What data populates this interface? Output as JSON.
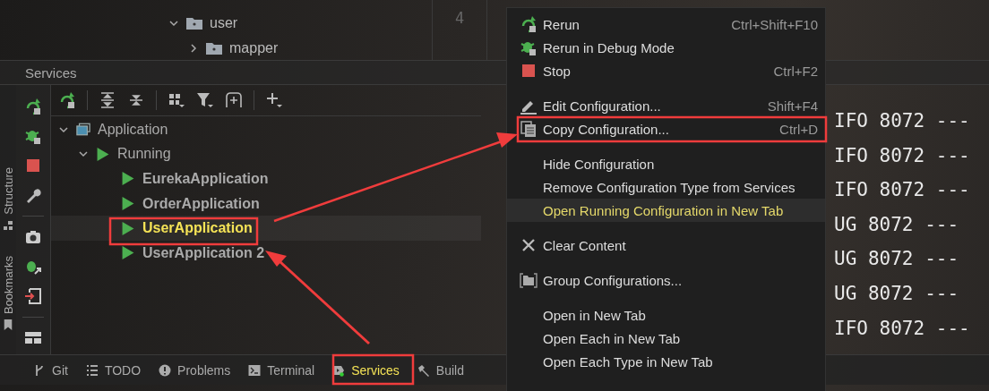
{
  "project_tree": [
    {
      "label": "user",
      "expanded": true,
      "children": [
        {
          "label": "mapper",
          "expanded": false
        }
      ]
    }
  ],
  "editor": {
    "line_number": "4"
  },
  "services": {
    "title": "Services",
    "side_labels": [
      "Structure",
      "Bookmarks"
    ],
    "tree": [
      {
        "label": "Application",
        "expanded": true,
        "kind": "group",
        "children": [
          {
            "label": "Running",
            "expanded": true,
            "kind": "status",
            "children": [
              {
                "label": "EurekaApplication",
                "kind": "app",
                "selected": false
              },
              {
                "label": "OrderApplication",
                "kind": "app",
                "selected": false
              },
              {
                "label": "UserApplication",
                "kind": "app",
                "selected": true
              },
              {
                "label": "UserApplication 2",
                "kind": "app",
                "selected": false
              }
            ]
          }
        ]
      }
    ]
  },
  "console_lines": [
    "IFO 8072 ---",
    "IFO 8072 ---",
    "IFO 8072 ---",
    "UG 8072 ---",
    "UG 8072 ---",
    "UG 8072 ---",
    "IFO 8072 ---"
  ],
  "context_menu": [
    {
      "kind": "item",
      "label": "Rerun",
      "shortcut": "Ctrl+Shift+F10",
      "highlighted": false
    },
    {
      "kind": "item",
      "label": "Rerun in Debug Mode",
      "highlighted": false
    },
    {
      "kind": "item",
      "label": "Stop",
      "shortcut": "Ctrl+F2",
      "highlighted": false
    },
    {
      "kind": "separator"
    },
    {
      "kind": "item",
      "label": "Edit Configuration...",
      "shortcut": "Shift+F4",
      "highlighted": false
    },
    {
      "kind": "item",
      "label": "Copy Configuration...",
      "shortcut": "Ctrl+D",
      "highlighted": false
    },
    {
      "kind": "separator"
    },
    {
      "kind": "item",
      "label": "Hide Configuration",
      "highlighted": false
    },
    {
      "kind": "item",
      "label": "Remove Configuration Type from Services",
      "highlighted": false
    },
    {
      "kind": "item",
      "label": "Open Running Configuration in New Tab",
      "highlighted": true
    },
    {
      "kind": "separator"
    },
    {
      "kind": "item",
      "label": "Clear Content",
      "highlighted": false
    },
    {
      "kind": "separator"
    },
    {
      "kind": "item",
      "label": "Group Configurations...",
      "highlighted": false
    },
    {
      "kind": "separator"
    },
    {
      "kind": "item",
      "label": "Open in New Tab",
      "highlighted": false
    },
    {
      "kind": "item",
      "label": "Open Each in New Tab",
      "highlighted": false
    },
    {
      "kind": "item",
      "label": "Open Each Type in New Tab",
      "highlighted": false
    }
  ],
  "bottom_tabs": [
    {
      "label": "Git",
      "selected": false
    },
    {
      "label": "TODO",
      "selected": false
    },
    {
      "label": "Problems",
      "selected": false
    },
    {
      "label": "Terminal",
      "selected": false
    },
    {
      "label": "Services",
      "selected": true
    },
    {
      "label": "Build",
      "selected": false
    }
  ]
}
